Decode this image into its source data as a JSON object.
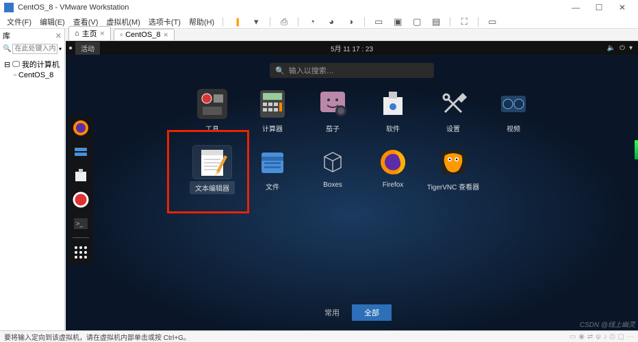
{
  "window": {
    "title": "CentOS_8 - VMware Workstation"
  },
  "menus": {
    "file": "文件(F)",
    "edit": "编辑(E)",
    "view": "查看(V)",
    "vm": "虚拟机(M)",
    "tabs": "选项卡(T)",
    "help": "帮助(H)"
  },
  "library": {
    "title": "库",
    "search_placeholder": "在此处键入内容…",
    "root": "我的计算机",
    "child": "CentOS_8"
  },
  "tabs": {
    "home": "主页",
    "vm": "CentOS_8"
  },
  "gnome": {
    "activities": "活动",
    "date": "5月 11 17 : 23",
    "search_placeholder": "输入以搜索…",
    "apps_row1": [
      {
        "label": "工具"
      },
      {
        "label": "计算器"
      },
      {
        "label": "茄子"
      },
      {
        "label": "软件"
      },
      {
        "label": "设置"
      },
      {
        "label": "视频"
      }
    ],
    "apps_row2": [
      {
        "label": "文本编辑器"
      },
      {
        "label": "文件"
      },
      {
        "label": "Boxes"
      },
      {
        "label": "Firefox"
      },
      {
        "label": "TigerVNC 查看器"
      }
    ],
    "toggle": {
      "frequent": "常用",
      "all": "全部"
    }
  },
  "statusbar": {
    "hint": "要将输入定向到该虚拟机，请在虚拟机内部单击或按 Ctrl+G。"
  },
  "watermark": "CSDN @线上幽灵"
}
